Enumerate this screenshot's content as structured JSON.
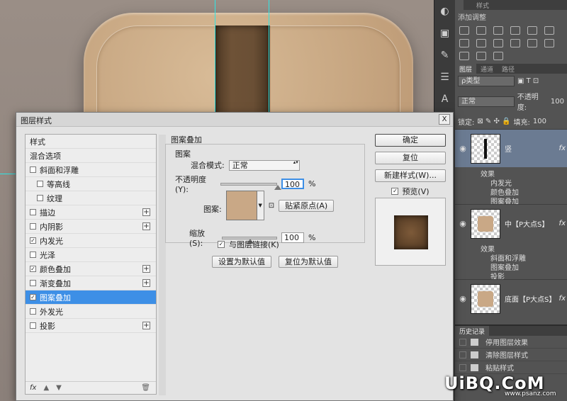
{
  "dialog": {
    "title": "图层样式",
    "close": "X",
    "style_list": [
      {
        "label": "样式",
        "checkbox": false,
        "checked": false,
        "indent": false,
        "plus": false,
        "selected": false
      },
      {
        "label": "混合选项",
        "checkbox": false,
        "checked": false,
        "indent": false,
        "plus": false,
        "selected": false
      },
      {
        "label": "斜面和浮雕",
        "checkbox": true,
        "checked": false,
        "indent": false,
        "plus": false,
        "selected": false
      },
      {
        "label": "等高线",
        "checkbox": true,
        "checked": false,
        "indent": true,
        "plus": false,
        "selected": false
      },
      {
        "label": "纹理",
        "checkbox": true,
        "checked": false,
        "indent": true,
        "plus": false,
        "selected": false
      },
      {
        "label": "描边",
        "checkbox": true,
        "checked": false,
        "indent": false,
        "plus": true,
        "selected": false
      },
      {
        "label": "内阴影",
        "checkbox": true,
        "checked": false,
        "indent": false,
        "plus": true,
        "selected": false
      },
      {
        "label": "内发光",
        "checkbox": true,
        "checked": true,
        "indent": false,
        "plus": false,
        "selected": false
      },
      {
        "label": "光泽",
        "checkbox": true,
        "checked": false,
        "indent": false,
        "plus": false,
        "selected": false
      },
      {
        "label": "颜色叠加",
        "checkbox": true,
        "checked": true,
        "indent": false,
        "plus": true,
        "selected": false
      },
      {
        "label": "渐变叠加",
        "checkbox": true,
        "checked": false,
        "indent": false,
        "plus": true,
        "selected": false
      },
      {
        "label": "图案叠加",
        "checkbox": true,
        "checked": true,
        "indent": false,
        "plus": false,
        "selected": true
      },
      {
        "label": "外发光",
        "checkbox": true,
        "checked": false,
        "indent": false,
        "plus": false,
        "selected": false
      },
      {
        "label": "投影",
        "checkbox": true,
        "checked": false,
        "indent": false,
        "plus": true,
        "selected": false
      }
    ],
    "list_footer": {
      "fx": "fx",
      "up": "▲",
      "down": "▼",
      "trash": "🗑"
    },
    "group_title": "图案叠加",
    "sub_title": "图案",
    "blend_mode_label": "混合模式:",
    "blend_mode_value": "正常",
    "opacity_label": "不透明度(Y):",
    "opacity_value": "100",
    "opacity_level": 1.0,
    "percent": "%",
    "pattern_label": "图案:",
    "snap_origin_button": "贴紧原点(A)",
    "scale_label": "缩放(S):",
    "scale_value": "100",
    "scale_level": 0.5,
    "link_label": "与图层链接(K)",
    "link_checked": true,
    "set_default_button": "设置为默认值",
    "reset_default_button": "复位为默认值",
    "ok_button": "确定",
    "reset_button": "复位",
    "new_style_button": "新建样式(W)...",
    "preview_label": "预览(V)",
    "preview_checked": true
  },
  "panels": {
    "adjust_tabs": [
      "",
      "",
      "样式"
    ],
    "adjust_title": "添加调整",
    "layer_tabs": [
      "图层",
      "通道",
      "路径"
    ],
    "kind_filter": "ρ类型",
    "blend": "正常",
    "opacity_label": "不透明度:",
    "opacity_value": "100",
    "lock_label": "锁定:",
    "fill_label": "填充:",
    "fill_value": "100",
    "layers": [
      {
        "name": "竖",
        "selected": true,
        "thumb": "bar",
        "effects_label": "效果",
        "effects": [
          "内发光",
          "颜色叠加",
          "图案叠加"
        ]
      },
      {
        "name": "中【P大点S】",
        "selected": false,
        "thumb": "tile",
        "effects_label": "效果",
        "effects": [
          "斜面和浮雕",
          "图案叠加",
          "投影"
        ]
      },
      {
        "name": "底面【P大点S】",
        "selected": false,
        "thumb": "tile",
        "effects_label": "效果",
        "effects": []
      }
    ],
    "fx": "fx",
    "history_title": "历史记录",
    "history": [
      "停用图层效果",
      "清除图层样式",
      "粘贴样式"
    ]
  },
  "watermark": {
    "text": "UiBQ.CoM",
    "sub": "www.psanz.com"
  }
}
